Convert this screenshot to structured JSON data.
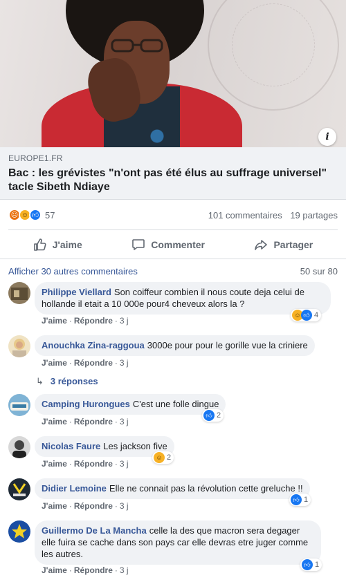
{
  "post": {
    "domain": "EUROPE1.FR",
    "title": "Bac : les grévistes \"n'ont pas été élus au suffrage universel\" tacle Sibeth Ndiaye",
    "info_glyph": "i"
  },
  "reactions": {
    "types": [
      "angry",
      "haha",
      "like"
    ],
    "count": "57",
    "comments": "101 commentaires",
    "shares": "19 partages"
  },
  "actions": {
    "like": "J'aime",
    "comment": "Commenter",
    "share": "Partager"
  },
  "comments_header": {
    "more": "Afficher 30 autres commentaires",
    "count": "50 sur 80"
  },
  "comment_actions": {
    "like": "J'aime",
    "reply": "Répondre",
    "separator": "·"
  },
  "comments": [
    {
      "author": "Philippe Viellard",
      "text": "Son coiffeur combien il nous coute deja celui de hollande il etait a 10 000e pour4 cheveux alors la ?",
      "time": "3 j",
      "reactions": [
        "haha",
        "like"
      ],
      "reaction_count": "4"
    },
    {
      "author": "Anouchka Zina-raggoua",
      "text": "3000e pour pour le gorille vue la criniere",
      "time": "3 j",
      "reactions": [],
      "reaction_count": ""
    },
    {
      "author": "Camping Hurongues",
      "text": "C'est une folle dingue",
      "time": "3 j",
      "reactions": [
        "like"
      ],
      "reaction_count": "2"
    },
    {
      "author": "Nicolas Faure",
      "text": "Les jackson five",
      "time": "3 j",
      "reactions": [
        "haha"
      ],
      "reaction_count": "2"
    },
    {
      "author": "Didier Lemoine",
      "text": "Elle ne connait pas la révolution cette greluche !!",
      "time": "3 j",
      "reactions": [
        "like"
      ],
      "reaction_count": "1"
    },
    {
      "author": "Guillermo De La Mancha",
      "text": "celle la des que macron sera degager elle fuira se cache dans son pays car elle devras etre juger comme les autres.",
      "time": "3 j",
      "reactions": [
        "like"
      ],
      "reaction_count": "1"
    }
  ],
  "replies_link": "3 réponses",
  "colors": {
    "link_blue": "#385898",
    "like_blue": "#1877f2",
    "angry_orange": "#e9710f",
    "haha_yellow": "#f7b125",
    "bubble_grey": "#f0f2f5",
    "meta_grey": "#606770"
  }
}
